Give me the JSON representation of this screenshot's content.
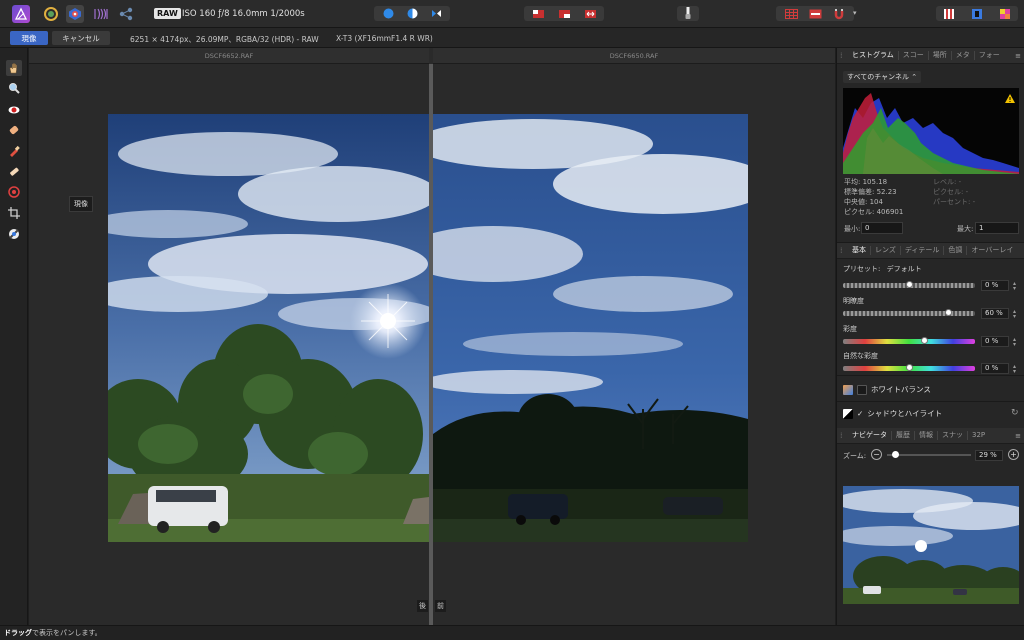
{
  "toolbar": {
    "persona_icons": [
      "affinity-logo-icon",
      "develop-persona-icon",
      "tone-map-persona-icon",
      "liquify-persona-icon",
      "export-persona-icon"
    ],
    "raw_badge": "RAW",
    "exif": "ISO 160 ƒ/8 16.0mm 1/2000s",
    "view_buttons": [
      "single-view-icon",
      "split-view-icon",
      "mirror-view-icon"
    ],
    "overlay_buttons": [
      "clipping-shadows-icon",
      "clipping-highlights-icon",
      "clipping-tones-icon"
    ],
    "tool_button": "paintbrush-icon",
    "grid_buttons": [
      "grid-icon",
      "overlay-icon",
      "magnet-icon",
      "dropdown-caret-icon"
    ],
    "right_buttons": [
      "assistant-icon",
      "color-icon",
      "swatch-icon"
    ]
  },
  "context": {
    "develop_label": "現像",
    "cancel_label": "キャンセル",
    "image_info": "6251 × 4174px、26.09MP、RGBA/32 (HDR) - RAW",
    "camera": "X-T3 (XF16mmF1.4 R WR)"
  },
  "tools": [
    "hand-tool-icon",
    "zoom-tool-icon",
    "red-eye-tool-icon",
    "blemish-tool-icon",
    "overlay-paint-tool-icon",
    "overlay-erase-tool-icon",
    "gradient-tool-icon",
    "crop-tool-icon",
    "white-balance-picker-icon"
  ],
  "canvas": {
    "left_file": "DSCF6652.RAF",
    "right_file": "DSCF6650.RAF",
    "tooltip": "現像",
    "after_label": "後",
    "before_label": "前"
  },
  "status": {
    "bold": "ドラッグ",
    "text": "で表示をパンします。"
  },
  "histogram_panel": {
    "tabs": [
      "ヒストグラム",
      "スコー",
      "場所",
      "メタ",
      "フォー"
    ],
    "channel_select": "すべてのチャンネル",
    "warning_icon": "clipping-warning-icon",
    "stats": [
      "平均: 105.18",
      "標準偏差: 52.23",
      "中央値: 104",
      "ピクセル: 406901"
    ],
    "stats_right": [
      "レベル: -",
      "ピクセル: -",
      "パーセント: -"
    ],
    "min_label": "最小:",
    "min_value": "0",
    "max_label": "最大:",
    "max_value": "1"
  },
  "develop_panel": {
    "tabs": [
      "基本",
      "レンズ",
      "ディテール",
      "色調",
      "オーバーレイ"
    ],
    "preset_label": "プリセット:",
    "preset_value": "デフォルト",
    "sliders": [
      {
        "label": "",
        "value": "0 %",
        "level": 0.5,
        "style": "checker"
      },
      {
        "label": "明瞭度",
        "value": "60 %",
        "level": 0.8,
        "style": "checker"
      },
      {
        "label": "彩度",
        "value": "0 %",
        "level": 0.62,
        "style": "rainbow"
      },
      {
        "label": "自然な彩度",
        "value": "0 %",
        "level": 0.5,
        "style": "rainbow"
      }
    ],
    "white_balance": "ホワイトバランス",
    "shadows_highlights": "シャドウとハイライト",
    "shadows_check": "✓"
  },
  "navigator_panel": {
    "tabs": [
      "ナビゲータ",
      "履歴",
      "情報",
      "スナッ",
      "32P"
    ],
    "zoom_label": "ズーム:",
    "zoom_value": "29 %",
    "zoom_level": 0.1
  }
}
